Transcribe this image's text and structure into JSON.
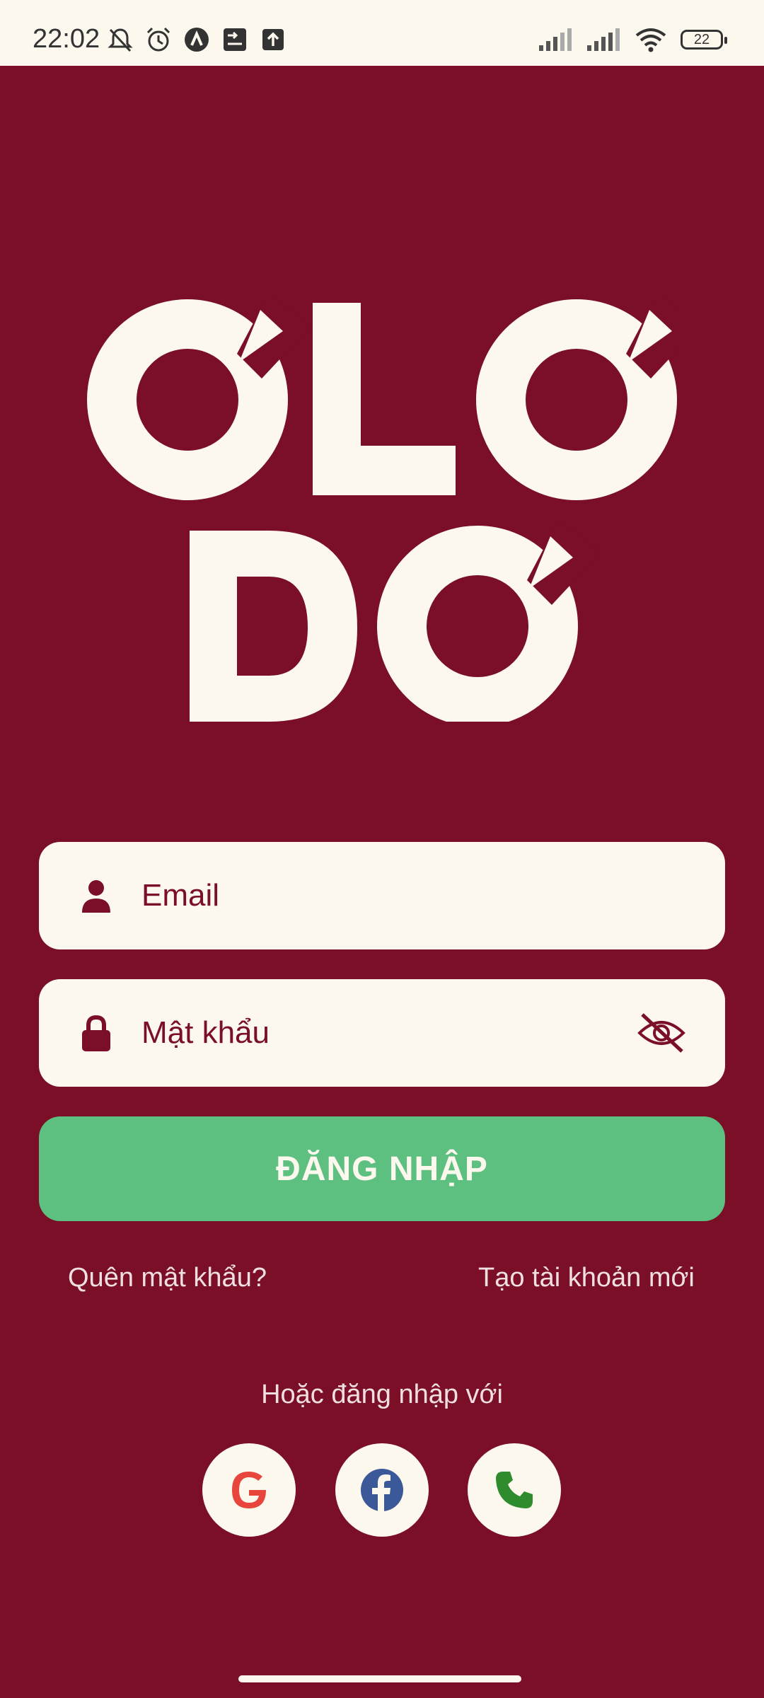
{
  "status_bar": {
    "time": "22:02",
    "battery": "22",
    "icons_left": [
      "bell-off-icon",
      "alarm-icon",
      "app-a-icon",
      "app-transfer-icon",
      "upload-icon"
    ],
    "icons_right": [
      "signal-icon",
      "signal-icon",
      "wifi-icon",
      "battery-icon"
    ]
  },
  "login": {
    "email_placeholder": "Email",
    "password_placeholder": "Mật khẩu",
    "login_button": "ĐĂNG NHẬP",
    "forgot_password": "Quên mật khẩu?",
    "create_account": "Tạo tài khoản mới",
    "or_login_with": "Hoặc đăng nhập với"
  },
  "social": [
    "google-icon",
    "facebook-icon",
    "phone-icon"
  ],
  "colors": {
    "background": "#7a0f27",
    "cream": "#fcf8ee",
    "button": "#5dc080",
    "google": "#e8453c",
    "facebook": "#3b5998",
    "phone": "#2e8b2e"
  }
}
